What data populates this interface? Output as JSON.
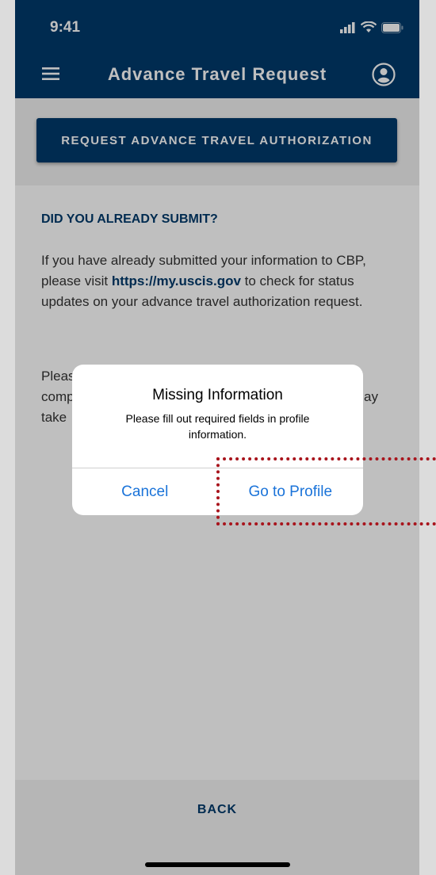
{
  "status_bar": {
    "time": "9:41"
  },
  "app_bar": {
    "title": "Advance Travel Request"
  },
  "primary_button": {
    "label": "REQUEST ADVANCE TRAVEL AUTHORIZATION"
  },
  "section": {
    "heading": "DID YOU ALREADY SUBMIT?",
    "p1_before": "If you have already submitted your information to CBP, please visit ",
    "p1_link": "https://my.uscis.gov",
    "p1_after": " to check for status updates on your advance travel authorization request.",
    "p2_visible": "Pleas\ncomp\ntake",
    "p2_visible_right": "ay"
  },
  "bottom_bar": {
    "back_label": "BACK"
  },
  "dialog": {
    "title": "Missing Information",
    "message": "Please fill out required fields in profile information.",
    "cancel_label": "Cancel",
    "confirm_label": "Go to Profile"
  },
  "colors": {
    "brand_navy": "#003a6b",
    "dialog_button_blue": "#1a73d9",
    "highlight_red": "#a8141c"
  },
  "icons": {
    "menu": "hamburger-icon",
    "profile": "user-circle-icon",
    "signal": "signal-icon",
    "wifi": "wifi-icon",
    "battery": "battery-icon"
  }
}
